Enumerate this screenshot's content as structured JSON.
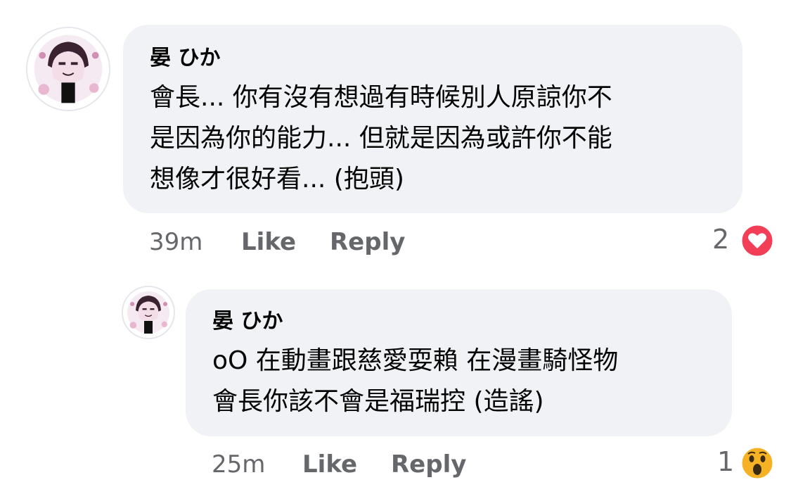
{
  "comments": [
    {
      "author": "晏 ひか",
      "lines": [
        "會長... 你有沒有想過有時候別人原諒你不",
        "是因為你的能力... 但就是因為或許你不能",
        "想像才很好看... (抱頭)"
      ],
      "time": "39m",
      "like_label": "Like",
      "reply_label": "Reply",
      "reaction_count": "2",
      "reaction_icon": "heart-reaction-icon",
      "reaction_color": "#f33e58"
    },
    {
      "author": "晏 ひか",
      "lines": [
        "oO 在動畫跟慈愛耍賴 在漫畫騎怪物",
        "會長你該不會是福瑞控 (造謠)"
      ],
      "time": "25m",
      "like_label": "Like",
      "reply_label": "Reply",
      "reaction_count": "1",
      "reaction_icon": "wow-reaction-icon",
      "reaction_color": "#f7b125"
    }
  ],
  "colors": {
    "bubble": "#f0f2f5",
    "text": "#050505",
    "secondary": "#65676b"
  }
}
